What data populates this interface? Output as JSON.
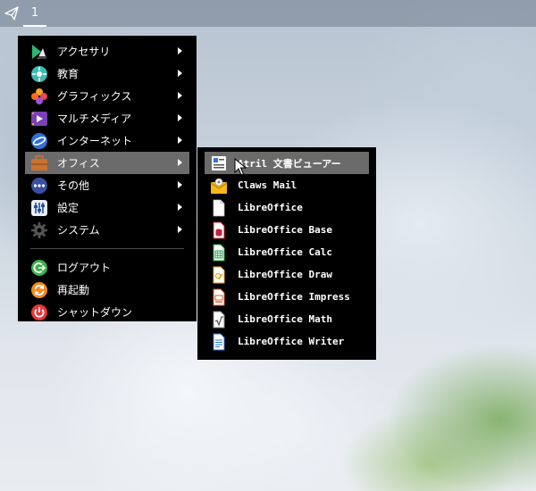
{
  "taskbar": {
    "launcher_icon": "paper-plane-icon",
    "workspace_label": "1"
  },
  "main_menu": {
    "items": [
      {
        "label": "アクセサリ",
        "icon": "accessories-icon",
        "submenu": true
      },
      {
        "label": "教育",
        "icon": "education-icon",
        "submenu": true
      },
      {
        "label": "グラフィックス",
        "icon": "graphics-icon",
        "submenu": true
      },
      {
        "label": "マルチメディア",
        "icon": "multimedia-icon",
        "submenu": true
      },
      {
        "label": "インターネット",
        "icon": "internet-icon",
        "submenu": true
      },
      {
        "label": "オフィス",
        "icon": "office-icon",
        "submenu": true,
        "active": true
      },
      {
        "label": "その他",
        "icon": "other-icon",
        "submenu": true
      },
      {
        "label": "設定",
        "icon": "settings-icon",
        "submenu": true
      },
      {
        "label": "システム",
        "icon": "system-icon",
        "submenu": true
      }
    ],
    "session_items": [
      {
        "label": "ログアウト",
        "icon": "logout-icon"
      },
      {
        "label": "再起動",
        "icon": "reboot-icon"
      },
      {
        "label": "シャットダウン",
        "icon": "shutdown-icon"
      }
    ]
  },
  "office_submenu": {
    "items": [
      {
        "label": "Atril 文書ビューアー",
        "icon": "atril-document-viewer-icon",
        "active": true
      },
      {
        "label": "Claws Mail",
        "icon": "claws-mail-icon"
      },
      {
        "label": "LibreOffice",
        "icon": "libreoffice-icon"
      },
      {
        "label": "LibreOffice Base",
        "icon": "libreoffice-base-icon"
      },
      {
        "label": "LibreOffice Calc",
        "icon": "libreoffice-calc-icon"
      },
      {
        "label": "LibreOffice Draw",
        "icon": "libreoffice-draw-icon"
      },
      {
        "label": "LibreOffice Impress",
        "icon": "libreoffice-impress-icon"
      },
      {
        "label": "LibreOffice Math",
        "icon": "libreoffice-math-icon"
      },
      {
        "label": "LibreOffice Writer",
        "icon": "libreoffice-writer-icon"
      }
    ]
  },
  "colors": {
    "menu_bg": "#000000",
    "menu_text": "#ffffff",
    "active_bg": "#6b6b6b",
    "taskbar_bg": "#6e7c8c"
  }
}
